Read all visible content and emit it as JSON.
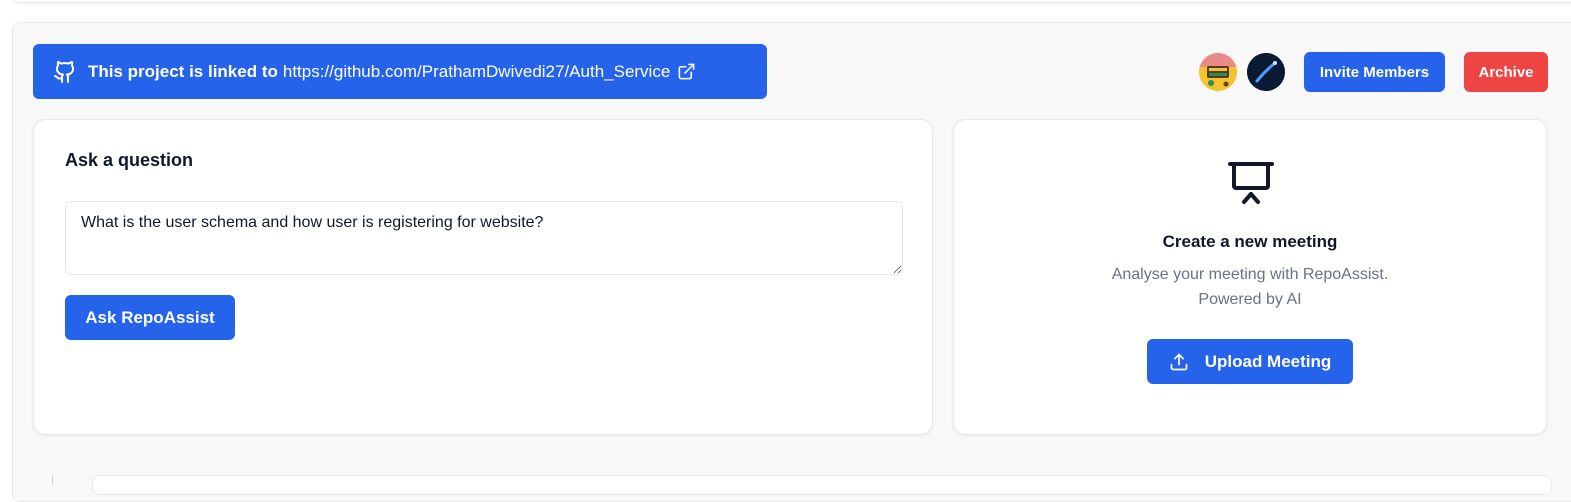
{
  "banner": {
    "prefix": "This project is linked to",
    "link": "https://github.com/PrathamDwivedi27/Auth_Service",
    "icon": "github-icon",
    "link_icon": "external-link-icon"
  },
  "members": [
    {
      "name": "member-avatar-1"
    },
    {
      "name": "member-avatar-2"
    }
  ],
  "actions": {
    "invite_label": "Invite Members",
    "archive_label": "Archive"
  },
  "ask": {
    "title": "Ask a question",
    "question": "What is the user schema and how user is registering for website?",
    "button_label": "Ask RepoAssist"
  },
  "meeting": {
    "icon": "presentation-icon",
    "title": "Create a new meeting",
    "description_line1": "Analyse your meeting with RepoAssist.",
    "description_line2": "Powered by AI",
    "upload_label": "Upload Meeting",
    "upload_icon": "upload-icon"
  },
  "colors": {
    "primary": "#2563eb",
    "danger": "#ef4444",
    "panel_bg": "#f8f8f8"
  }
}
